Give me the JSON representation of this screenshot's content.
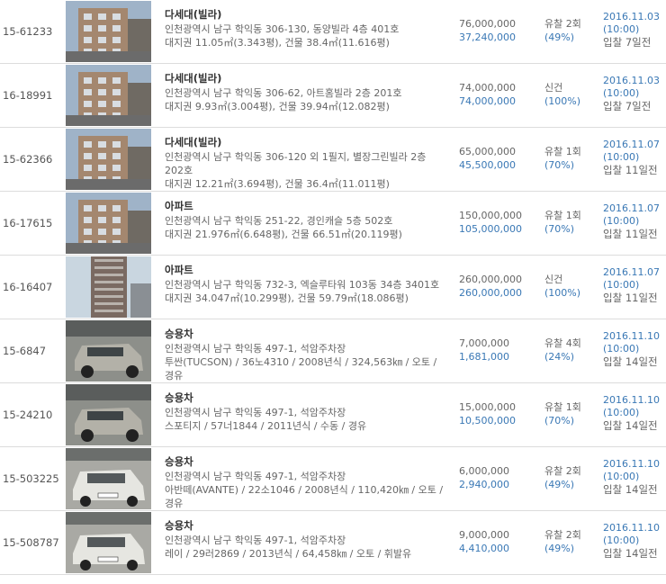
{
  "rows": [
    {
      "case_no": "15-61233",
      "type": "다세대(빌라)",
      "lines": [
        "인천광역시 남구 학익동 306-130, 동양빌라 4층 401호",
        "대지권 11.05㎡(3.343평), 건물 38.4㎡(11.616평)"
      ],
      "appraisal": "76,000,000",
      "minimum": "37,240,000",
      "result": "유찰 2회",
      "ratio": "(49%)",
      "date": "2016.11.03",
      "time": "(10:00)",
      "due": "입찰 7일전",
      "photo": "building"
    },
    {
      "case_no": "16-18991",
      "type": "다세대(빌라)",
      "lines": [
        "인천광역시 남구 학익동 306-62, 아트홈빌라 2층 201호",
        "대지권 9.93㎡(3.004평), 건물 39.94㎡(12.082평)"
      ],
      "appraisal": "74,000,000",
      "minimum": "74,000,000",
      "result": "신건",
      "ratio": "(100%)",
      "date": "2016.11.03",
      "time": "(10:00)",
      "due": "입찰 7일전",
      "photo": "building"
    },
    {
      "case_no": "15-62366",
      "type": "다세대(빌라)",
      "lines": [
        "인천광역시 남구 학익동 306-120 외 1필지, 별장그린빌라 2층 202호",
        "대지권 12.21㎡(3.694평), 건물 36.4㎡(11.011평)"
      ],
      "appraisal": "65,000,000",
      "minimum": "45,500,000",
      "result": "유찰 1회",
      "ratio": "(70%)",
      "date": "2016.11.07",
      "time": "(10:00)",
      "due": "입찰 11일전",
      "photo": "building"
    },
    {
      "case_no": "16-17615",
      "type": "아파트",
      "lines": [
        "인천광역시 남구 학익동 251-22, 경인캐슬 5층 502호",
        "대지권 21.976㎡(6.648평), 건물 66.51㎡(20.119평)"
      ],
      "appraisal": "150,000,000",
      "minimum": "105,000,000",
      "result": "유찰 1회",
      "ratio": "(70%)",
      "date": "2016.11.07",
      "time": "(10:00)",
      "due": "입찰 11일전",
      "photo": "building"
    },
    {
      "case_no": "16-16407",
      "type": "아파트",
      "lines": [
        "인천광역시 남구 학익동 732-3, 엑슬루타워 103동 34층 3401호",
        "대지권 34.047㎡(10.299평), 건물 59.79㎡(18.086평)"
      ],
      "appraisal": "260,000,000",
      "minimum": "260,000,000",
      "result": "신건",
      "ratio": "(100%)",
      "date": "2016.11.07",
      "time": "(10:00)",
      "due": "입찰 11일전",
      "photo": "tower"
    },
    {
      "case_no": "15-6847",
      "type": "승용차",
      "lines": [
        "인천광역시 남구 학익동 497-1, 석암주차장",
        "투싼(TUCSON) / 36노4310 / 2008년식 / 324,563㎞ / 오토 / 경유"
      ],
      "appraisal": "7,000,000",
      "minimum": "1,681,000",
      "result": "유찰 4회",
      "ratio": "(24%)",
      "date": "2016.11.10",
      "time": "(10:00)",
      "due": "입찰 14일전",
      "photo": "car"
    },
    {
      "case_no": "15-24210",
      "type": "승용차",
      "lines": [
        "인천광역시 남구 학익동 497-1, 석암주차장",
        "스포티지 / 57너1844 / 2011년식 / 수동 / 경유"
      ],
      "appraisal": "15,000,000",
      "minimum": "10,500,000",
      "result": "유찰 1회",
      "ratio": "(70%)",
      "date": "2016.11.10",
      "time": "(10:00)",
      "due": "입찰 14일전",
      "photo": "car"
    },
    {
      "case_no": "15-503225",
      "type": "승용차",
      "lines": [
        "인천광역시 남구 학익동 497-1, 석암주차장",
        "아반떼(AVANTE) / 22소1046 / 2008년식 / 110,420㎞ / 오토 / 경유"
      ],
      "appraisal": "6,000,000",
      "minimum": "2,940,000",
      "result": "유찰 2회",
      "ratio": "(49%)",
      "date": "2016.11.10",
      "time": "(10:00)",
      "due": "입찰 14일전",
      "photo": "car-white"
    },
    {
      "case_no": "15-508787",
      "type": "승용차",
      "lines": [
        "인천광역시 남구 학익동 497-1, 석암주차장",
        "레이 / 29러2869 / 2013년식 / 64,458㎞ / 오토 / 휘발유"
      ],
      "appraisal": "9,000,000",
      "minimum": "4,410,000",
      "result": "유찰 2회",
      "ratio": "(49%)",
      "date": "2016.11.10",
      "time": "(10:00)",
      "due": "입찰 14일전",
      "photo": "car-white"
    }
  ]
}
